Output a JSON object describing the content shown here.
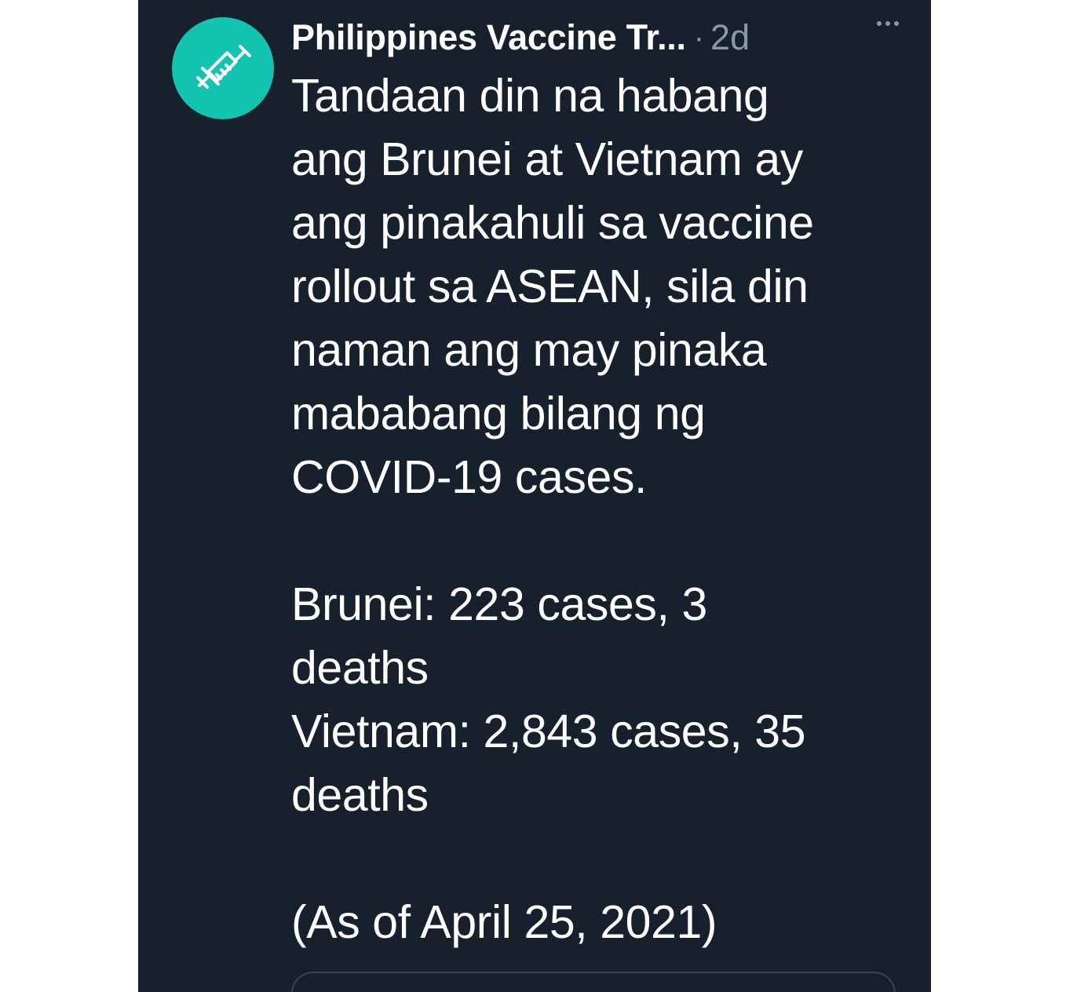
{
  "tweet": {
    "author": "Philippines Vaccine Tr...",
    "separator": "·",
    "time": "2d",
    "body_lines": [
      "Tandaan din na habang",
      "ang Brunei at Vietnam ay",
      "ang pinakahuli sa vaccine",
      "rollout sa ASEAN, sila din",
      "naman ang may pinaka",
      "mababang bilang ng",
      "COVID-19 cases.",
      "",
      "Brunei: 223 cases, 3",
      "deaths",
      "Vietnam: 2,843 cases, 35",
      "deaths",
      "",
      "(As of April 25, 2021)"
    ]
  },
  "icons": {
    "avatar": "syringe-icon",
    "more": "more-horizontal-icon"
  },
  "colors": {
    "background": "#17202d",
    "avatar_bg": "#12c3b0",
    "text": "#ffffff",
    "muted": "#8b98a5",
    "border": "#38444d"
  }
}
